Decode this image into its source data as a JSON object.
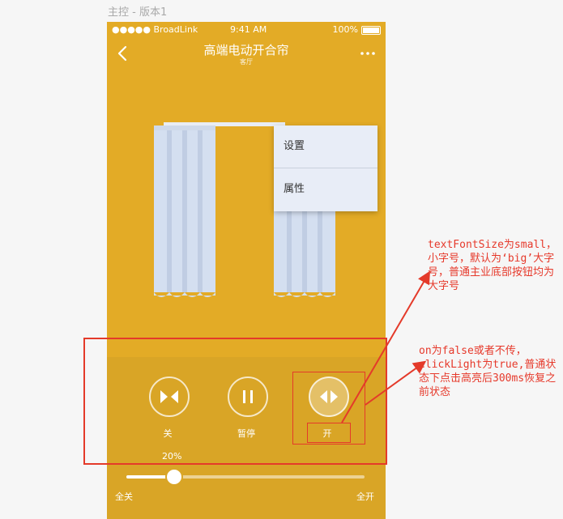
{
  "artboard": {
    "label": "主控 - 版本1"
  },
  "statusbar": {
    "carrier": "●●●●● BroadLink",
    "time": "9:41 AM",
    "battery": "100%"
  },
  "navbar": {
    "title": "高端电动开合帘",
    "subtitle": "客厅"
  },
  "menu": {
    "items": [
      {
        "label": "设置"
      },
      {
        "label": "属性"
      }
    ]
  },
  "controls": {
    "close_label": "关",
    "pause_label": "暂停",
    "open_label": "开",
    "percent_text": "20%",
    "position": 0.2,
    "slider_left": "全关",
    "slider_right": "全开"
  },
  "annotations": {
    "note1": "textFontSize为small，小字号，默认为‘big’大字号，普通主业底部按钮均为大字号",
    "note2": "on为false或者不传，clickLight为true,普通状态下点击高亮后300ms恢复之前状态"
  },
  "colors": {
    "background": "#e3ab26",
    "panel": "#d9a526",
    "annotation": "#e43a2a",
    "curtain": "#d4dff0"
  }
}
